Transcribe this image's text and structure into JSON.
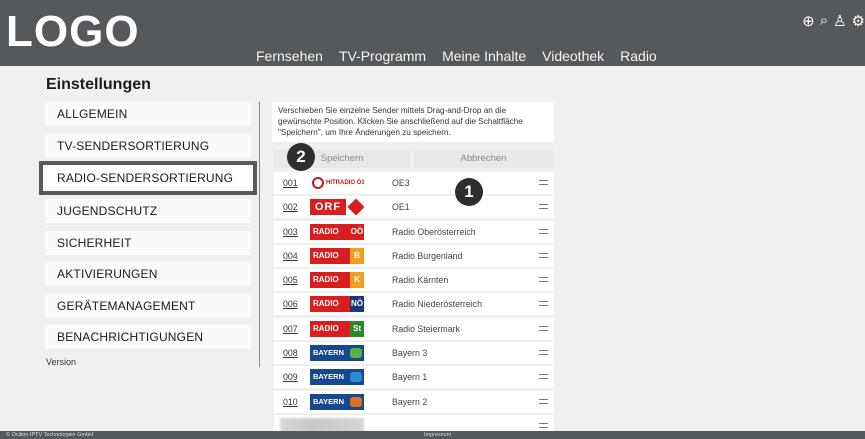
{
  "header": {
    "logo": "LOGO",
    "nav": [
      "Fernsehen",
      "TV-Programm",
      "Meine Inhalte",
      "Videothek",
      "Radio"
    ],
    "icons": [
      {
        "name": "add-circle-icon",
        "glyph": "⊕"
      },
      {
        "name": "search-icon",
        "glyph": "⌕"
      },
      {
        "name": "user-icon",
        "glyph": "♙"
      },
      {
        "name": "settings-icon",
        "glyph": "⚙"
      }
    ]
  },
  "page": {
    "title": "Einstellungen",
    "version_label": "Version"
  },
  "menu": {
    "active_index": 2,
    "items": [
      "ALLGEMEIN",
      "TV-SENDERSORTIERUNG",
      "RADIO-SENDERSORTIERUNG",
      "JUGENDSCHUTZ",
      "SICHERHEIT",
      "AKTIVIERUNGEN",
      "GERÄTEMANAGEMENT",
      "BENACHRICHTIGUNGEN"
    ]
  },
  "content": {
    "info_text": "Verschieben Sie einzelne Sender mittels Drag-and-Drop an die gewünschte Position. Klicken Sie anschließend auf die Schaltfläche \"Speichern\", um Ihre Änderungen zu speichern.",
    "save_label": "Speichern",
    "cancel_label": "Abbrechen",
    "badges": [
      "2",
      "1"
    ]
  },
  "stations": [
    {
      "num": "001",
      "logo": "oe3",
      "logo_text": "HITRADIO Ö3",
      "name": "OE3"
    },
    {
      "num": "002",
      "logo": "orf",
      "logo_text": "ORF",
      "name": "OE1"
    },
    {
      "num": "003",
      "logo": "radio",
      "logo_text": "RADIO",
      "tag": "OÖ",
      "tag_color": "#d81e1e",
      "name": "Radio Oberösterreich"
    },
    {
      "num": "004",
      "logo": "radio",
      "logo_text": "RADIO",
      "tag": "B",
      "tag_color": "#f0a020",
      "name": "Radio Burgenland"
    },
    {
      "num": "005",
      "logo": "radio",
      "logo_text": "RADIO",
      "tag": "K",
      "tag_color": "#f0a020",
      "name": "Radio Kärnten"
    },
    {
      "num": "006",
      "logo": "radio",
      "logo_text": "RADIO",
      "tag": "NÖ",
      "tag_color": "#1a3a7a",
      "name": "Radio Niederösterreich"
    },
    {
      "num": "007",
      "logo": "radio",
      "logo_text": "RADIO",
      "tag": "St",
      "tag_color": "#2a8a2a",
      "name": "Radio Steiermark"
    },
    {
      "num": "008",
      "logo": "bayern",
      "logo_text": "BAYERN",
      "tag_color": "#5ab040",
      "name": "Bayern 3"
    },
    {
      "num": "009",
      "logo": "bayern",
      "logo_text": "BAYERN",
      "tag_color": "#2a8ad0",
      "name": "Bayern 1"
    },
    {
      "num": "010",
      "logo": "bayern",
      "logo_text": "BAYERN",
      "tag_color": "#e07020",
      "name": "Bayern 2"
    },
    {
      "num": "",
      "logo": "blur",
      "logo_text": "",
      "name": ""
    }
  ],
  "footer": {
    "copyright": "© Ocilion IPTV Technologies GmbH",
    "impressum": "Impressum"
  }
}
